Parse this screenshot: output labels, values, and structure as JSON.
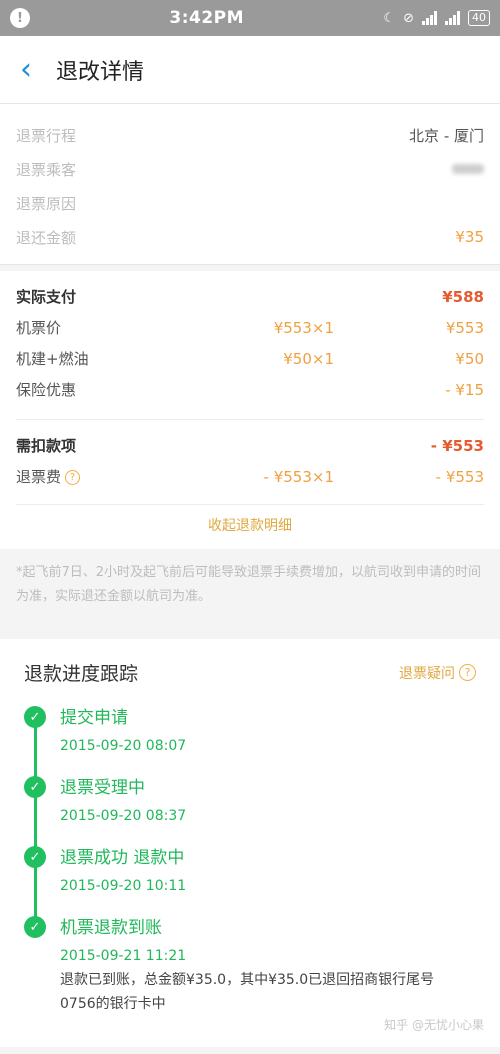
{
  "statusbar": {
    "time": "3:42PM",
    "battery": "40"
  },
  "navbar": {
    "title": "退改详情"
  },
  "basic": [
    {
      "label": "退票行程",
      "value": "北京 - 厦门"
    },
    {
      "label": "退票乘客",
      "value": ""
    },
    {
      "label": "退票原因",
      "value": ""
    },
    {
      "label": "退还金额",
      "value": "¥35"
    }
  ],
  "payment": {
    "title": "实际支付",
    "total": "¥588",
    "rows": [
      {
        "label": "机票价",
        "unit": "¥553×1",
        "amount": "¥553"
      },
      {
        "label": "机建+燃油",
        "unit": "¥50×1",
        "amount": "¥50"
      },
      {
        "label": "保险优惠",
        "unit": "",
        "amount": "- ¥15"
      }
    ]
  },
  "deduction": {
    "title": "需扣款项",
    "total": "- ¥553",
    "rows": [
      {
        "label": "退票费",
        "unit": "- ¥553×1",
        "amount": "- ¥553"
      }
    ]
  },
  "collapse_label": "收起退款明细",
  "notice": "*起飞前7日、2小时及起飞前后可能导致退票手续费增加，以航司收到申请的时间为准，实际退还金额以航司为准。",
  "tracking": {
    "title": "退款进度跟踪",
    "link_label": "退票疑问",
    "steps": [
      {
        "title": "提交申请",
        "time": "2015-09-20 08:07"
      },
      {
        "title": "退票受理中",
        "time": "2015-09-20 08:37"
      },
      {
        "title": "退票成功 退款中",
        "time": "2015-09-20 10:11"
      },
      {
        "title": "机票退款到账",
        "time": "2015-09-21 11:21",
        "desc": "退款已到账，总金额¥35.0，其中¥35.0已退回招商银行尾号0756的银行卡中"
      }
    ]
  },
  "watermark": "知乎 @无忧小心果",
  "icons": {
    "back": "chevron-left-icon",
    "check": "check-icon",
    "help": "question-circle-icon"
  },
  "colors": {
    "accent_blue": "#1a8ed8",
    "accent_orange": "#f0a040",
    "accent_green": "#20c060",
    "emphasis_red": "#e55b2d"
  }
}
